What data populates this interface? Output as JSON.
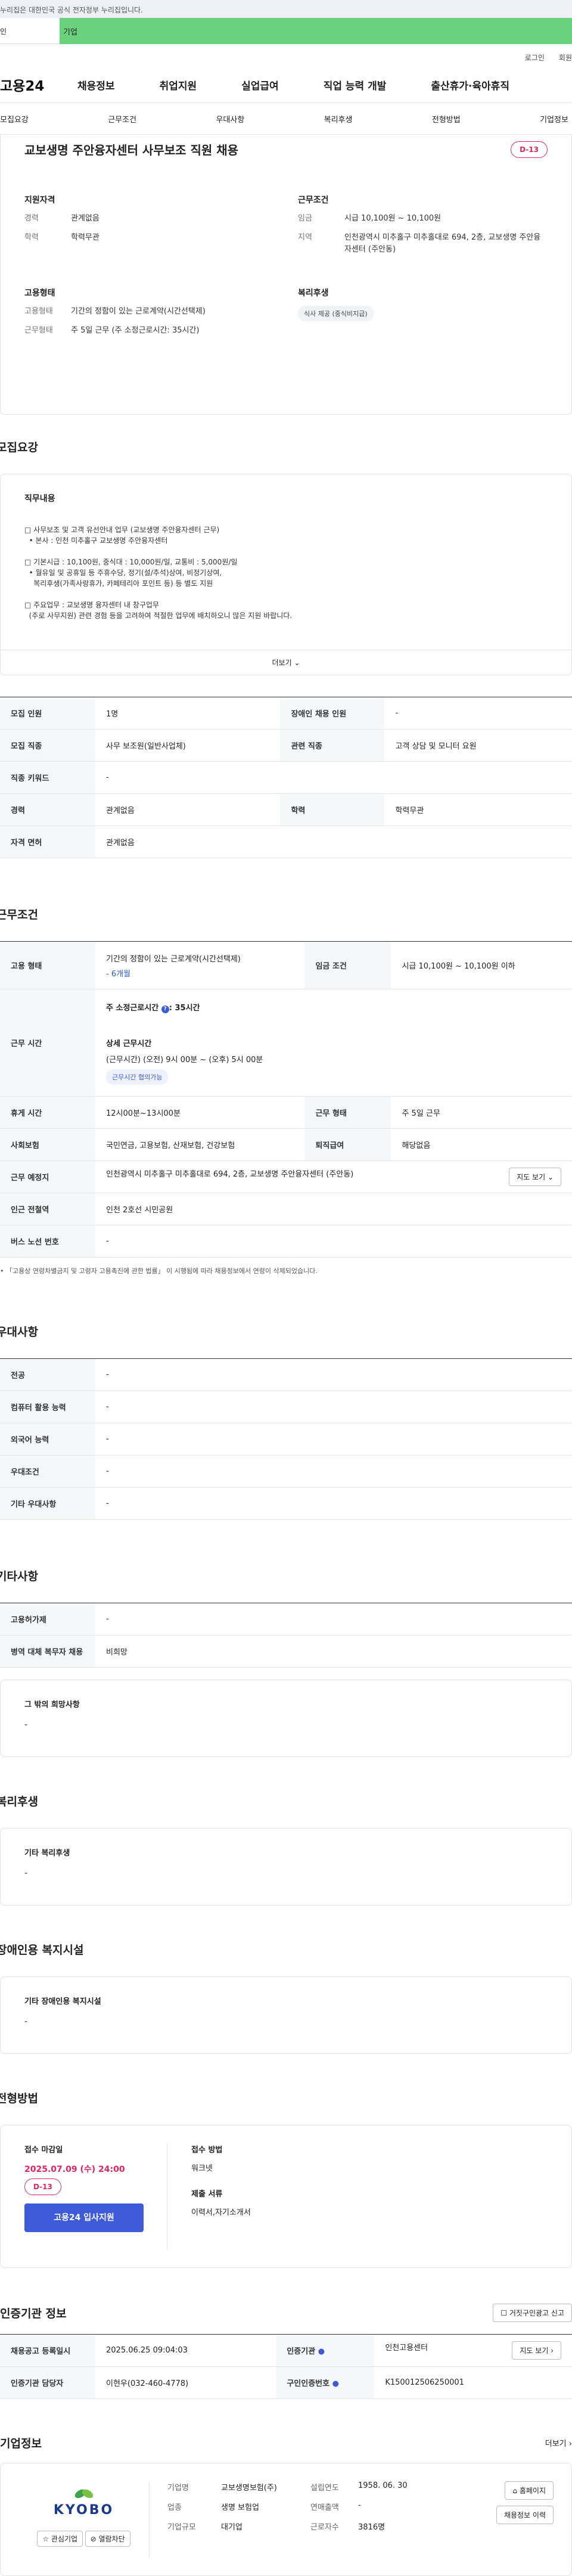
{
  "gov_banner": "누리집은 대한민국 공식 전자정부 누리집입니다.",
  "tabs": [
    "인",
    "기업"
  ],
  "toplinks": [
    "로그인",
    "회원"
  ],
  "logo": "고용24",
  "gnb": [
    "채용정보",
    "취업지원",
    "실업급여",
    "직업 능력 개발",
    "출산휴가·육아휴직"
  ],
  "snb": [
    "모집요강",
    "근무조건",
    "우대사항",
    "복리후생",
    "전형방법",
    "기업정보"
  ],
  "job": {
    "title": "교보생명 주안융자센터 사무보조 직원 채용",
    "dday": "D-13",
    "qual_title": "지원자격",
    "qual": [
      [
        "경력",
        "관계없음"
      ],
      [
        "학력",
        "학력무관"
      ]
    ],
    "cond_title": "근무조건",
    "cond": [
      [
        "임금",
        "시급 10,100원 ~ 10,100원"
      ],
      [
        "지역",
        "인천광역시 미추홀구 미추홀대로 694, 2층, 교보생명 주안융자센터 (주안동)"
      ]
    ],
    "emp_title": "고용형태",
    "emp": [
      [
        "고용형태",
        "기간의 정함이 있는 근로계약(시간선택제)"
      ],
      [
        "근무형태",
        "주 5일 근무 (주 소정근로시간: 35시간)"
      ]
    ],
    "welfare_title": "복리후생",
    "welfare_pill": "식사 제공 (중식비지급)"
  },
  "recruit": {
    "title": "모집요강",
    "duty_title": "직무내용",
    "duties": [
      "□ 사무보조 및 고객 유선안내 업무 (교보생명 주안융자센터 근무)",
      "  • 본사 : 인천 미추홀구 교보생명 주안융자센터",
      "□ 기본시급 : 10,100원, 중식대 : 10,000원/일, 교통비 : 5,000원/일",
      "  • 월유일 및 공휴일 등 주휴수당, 정기(설/추석)상여, 비정기상여,",
      "    복리후생(가족사랑휴가, 카페테리아 포인트 등) 등 별도 지원",
      "□ 주요업무 : 교보생명 융자센터 내 창구업무",
      "  (주로 사무지원) 관련 경험 등을 고려하여 적절한 업무에 배치하오니 많은 지원 바랍니다."
    ],
    "more": "더보기",
    "rows": [
      [
        "모집 인원",
        "1명",
        "장애인 채용 인원",
        "-"
      ],
      [
        "모집 직종",
        "사무 보조원(일반사업체)",
        "관련 직종",
        "고객 상담 및 모니터 요원"
      ],
      [
        "직종 키워드",
        "-",
        "",
        ""
      ],
      [
        "경력",
        "관계없음",
        "학력",
        "학력무관"
      ],
      [
        "자격 면허",
        "관계없음",
        "",
        ""
      ]
    ]
  },
  "work": {
    "title": "근무조건",
    "emp_k": "고용 형태",
    "emp_v": "기간의 정함이 있는 근로계약(시간선택제)",
    "emp_sub": "- 6개월",
    "wage_k": "임금 조건",
    "wage_v": "시급 10,100원 ~ 10,100원 이하",
    "time_k": "근무 시간",
    "time_h": "주 소정근로시간",
    "time_hv": ": 35시간",
    "time_d": "상세 근무시간",
    "time_dv": "(근무시간) (오전) 9시 00분 ~ (오후) 5시 00분",
    "time_tag": "근무시간 협의가능",
    "rows": [
      [
        "휴게 시간",
        "12시00분~13시00분",
        "근무 형태",
        "주 5일 근무"
      ],
      [
        "사회보험",
        "국민연금, 고용보험, 산재보험, 건강보험",
        "퇴직급여",
        "해당없음"
      ]
    ],
    "place_k": "근무 예정지",
    "place_v": "인천광역시 미추홀구 미추홀대로 694, 2층, 교보생명 주안융자센터 (주안동)",
    "map_btn": "지도 보기",
    "station_k": "인근 전철역",
    "station_v": "인천 2호선 시민공원",
    "bus_k": "버스 노선 번호",
    "bus_v": "-",
    "note": "• 「고용상 연령차별금지 및 고령자 고용촉진에 관한 법률」 이 시행됨에 따라 채용정보에서 연령이 삭제되었습니다."
  },
  "pref": {
    "title": "우대사항",
    "rows": [
      [
        "전공",
        "-"
      ],
      [
        "컴퓨터 활용 능력",
        "-"
      ],
      [
        "외국어 능력",
        "-"
      ],
      [
        "우대조건",
        "-"
      ],
      [
        "기타 우대사항",
        "-"
      ]
    ]
  },
  "etc": {
    "title": "기타사항",
    "rows": [
      [
        "고용허가제",
        "-"
      ],
      [
        "병역 대체 복무자 채용",
        "비희망"
      ]
    ],
    "box_title": "그 밖의 희망사항",
    "box_v": "-"
  },
  "welfare": {
    "title": "복리후생",
    "box_title": "기타 복리후생",
    "box_v": "-"
  },
  "disab": {
    "title": "장애인용 복지시설",
    "box_title": "기타 장애인용 복지시설",
    "box_v": "-"
  },
  "apply": {
    "title": "전형방법",
    "deadline_k": "접수 마감일",
    "deadline_v": "2025.07.09 (수) 24:00",
    "dday": "D-13",
    "btn": "고용24 입사지원",
    "method_k": "접수 방법",
    "method_v": "워크넷",
    "docs_k": "제출 서류",
    "docs_v": "이력서,자기소개서"
  },
  "cert": {
    "title": "인증기관 정보",
    "report_btn": "거짓구인광고 신고",
    "rows": [
      [
        "채용공고 등록일시",
        "2025.06.25 09:04:03",
        "인증기관",
        "인천고용센터"
      ],
      [
        "인증기관 담당자",
        "이현우(032-460-4778)",
        "구인인증번호",
        "K150012506250001"
      ]
    ],
    "map_btn": "지도 보기"
  },
  "company": {
    "title": "기업정보",
    "more": "더보기",
    "logo": "KYOBO",
    "fav": "관심기업",
    "block": "열람차단",
    "info": [
      [
        "기업명",
        "교보생명보험(주)",
        "설립연도",
        "1958. 06. 30"
      ],
      [
        "업종",
        "생명 보험업",
        "연매출액",
        "-"
      ],
      [
        "기업규모",
        "대기업",
        "근로자수",
        "3816명"
      ]
    ],
    "home": "홈페이지",
    "jobs": "채용정보 이력"
  },
  "colors": {
    "accent": "#3d5bd9",
    "dday": "#e0245e",
    "green": "#6ad27f",
    "logo_green": "#3fa34d",
    "logo_blue": "#1b3a8c"
  }
}
